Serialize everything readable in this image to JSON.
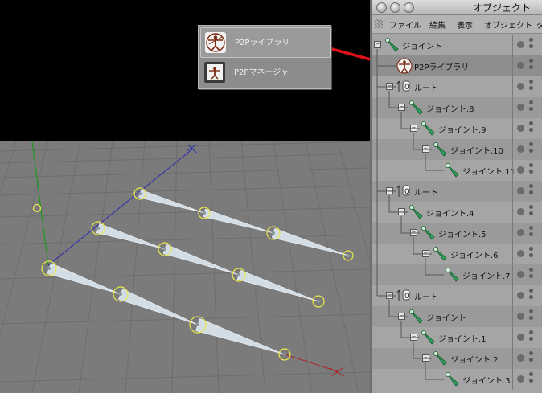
{
  "popup": {
    "items": [
      {
        "label": "P2Pライブラリ",
        "icon": "vitruvian-icon",
        "selected": true
      },
      {
        "label": "P2Pマネージャ",
        "icon": "vitruvian-manager-icon",
        "selected": false
      }
    ]
  },
  "object_manager": {
    "title": "オブジェクト",
    "menu": [
      "ファイル",
      "編集",
      "表示",
      "オブジェクト",
      "タ"
    ],
    "tree": [
      {
        "label": "ジョイント",
        "icon": "joint-icon",
        "depth": 0
      },
      {
        "label": "P2Pライブラリ",
        "icon": "vitruvian-icon",
        "depth": 1
      },
      {
        "label": "ルート",
        "icon": "null-root-icon",
        "depth": 1
      },
      {
        "label": "ジョイント.8",
        "icon": "joint-icon",
        "depth": 2
      },
      {
        "label": "ジョイント.9",
        "icon": "joint-icon",
        "depth": 3
      },
      {
        "label": "ジョイント.10",
        "icon": "joint-icon",
        "depth": 4
      },
      {
        "label": "ジョイント.11",
        "icon": "joint-icon",
        "depth": 5
      },
      {
        "label": "ルート",
        "icon": "null-root-icon",
        "depth": 1
      },
      {
        "label": "ジョイント.4",
        "icon": "joint-icon",
        "depth": 2
      },
      {
        "label": "ジョイント.5",
        "icon": "joint-icon",
        "depth": 3
      },
      {
        "label": "ジョイント.6",
        "icon": "joint-icon",
        "depth": 4
      },
      {
        "label": "ジョイント.7",
        "icon": "joint-icon",
        "depth": 5
      },
      {
        "label": "ルート",
        "icon": "null-root-icon",
        "depth": 1
      },
      {
        "label": "ジョイント",
        "icon": "joint-icon",
        "depth": 2
      },
      {
        "label": "ジョイント.1",
        "icon": "joint-icon",
        "depth": 3
      },
      {
        "label": "ジョイント.2",
        "icon": "joint-icon",
        "depth": 4
      },
      {
        "label": "ジョイント.3",
        "icon": "joint-icon",
        "depth": 5
      }
    ]
  },
  "colors": {
    "viewport_bg": "#7b7b7b",
    "grid_line": "#6a6a6a",
    "joint_bone": "#d3dde6",
    "joint_circle": "#e9e94a",
    "axis_x": "#b02020",
    "axis_y": "#1f9a1f",
    "axis_z": "#2020b0",
    "arrow": "#e0101a",
    "joint_icon_green": "#2f9e5a"
  }
}
